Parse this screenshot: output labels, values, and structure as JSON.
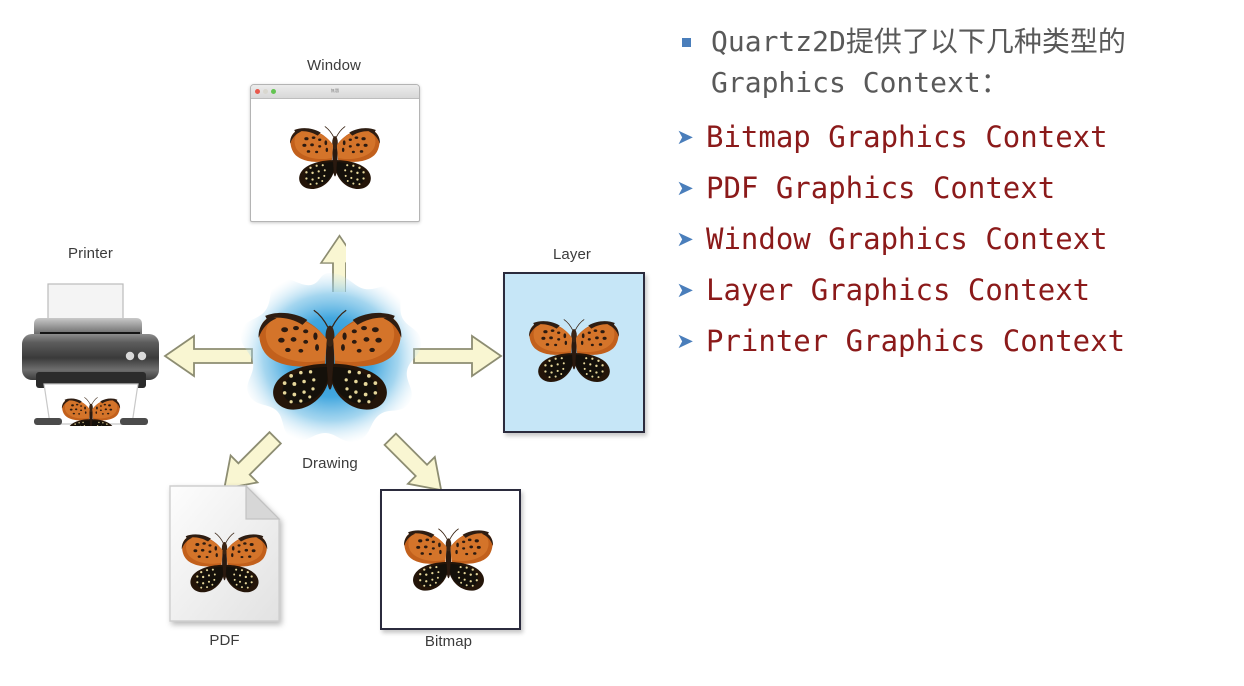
{
  "slide": {
    "background": "#ffffff",
    "bullet_square_color": "#4a7ebb",
    "bullet_arrow_color": "#4a7ebb",
    "heading_color": "#595959",
    "item_color": "#8b1a1a"
  },
  "content": {
    "heading": {
      "bullet": "square-bullet",
      "line1": "Quartz2D提供了以下几种类型的",
      "line2": "Graphics Context："
    },
    "items": [
      {
        "bullet": "arrow-bullet",
        "label": "Bitmap Graphics Context"
      },
      {
        "bullet": "arrow-bullet",
        "label": "PDF Graphics Context"
      },
      {
        "bullet": "arrow-bullet",
        "label": "Window Graphics Context"
      },
      {
        "bullet": "arrow-bullet",
        "label": "Layer Graphics Context"
      },
      {
        "bullet": "arrow-bullet",
        "label": "Printer Graphics Context"
      }
    ]
  },
  "diagram": {
    "center": {
      "label": "Drawing",
      "blob_color": "#2e9bd6",
      "image": "butterfly"
    },
    "nodes": [
      {
        "id": "window",
        "label": "Window",
        "label_position": "above",
        "image": "butterfly"
      },
      {
        "id": "layer",
        "label": "Layer",
        "label_position": "above",
        "image": "butterfly",
        "fill": "#c6e6f7"
      },
      {
        "id": "bitmap",
        "label": "Bitmap",
        "label_position": "below",
        "image": "butterfly",
        "fill": "#ffffff"
      },
      {
        "id": "pdf",
        "label": "PDF",
        "label_position": "below",
        "image": "butterfly"
      },
      {
        "id": "printer",
        "label": "Printer",
        "label_position": "above",
        "image": "butterfly"
      }
    ],
    "arrows": [
      {
        "id": "arrow-to-window",
        "direction": "up",
        "target": "window"
      },
      {
        "id": "arrow-to-layer",
        "direction": "right",
        "target": "layer"
      },
      {
        "id": "arrow-to-bitmap",
        "direction": "down-right",
        "target": "bitmap"
      },
      {
        "id": "arrow-to-pdf",
        "direction": "down-left",
        "target": "pdf"
      },
      {
        "id": "arrow-to-printer",
        "direction": "left",
        "target": "printer"
      }
    ],
    "arrow_fill": "#f9f6d2",
    "arrow_stroke": "#8d8d72",
    "label_color": "#3b3b3b"
  },
  "window_chrome": {
    "title": "無題",
    "buttons": [
      "close",
      "minimize",
      "zoom"
    ]
  }
}
